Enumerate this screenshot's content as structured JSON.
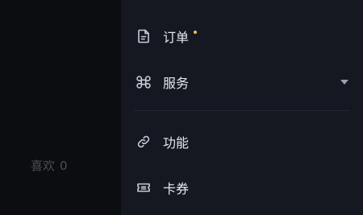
{
  "background": {
    "likes_label": "喜欢",
    "likes_count": "0"
  },
  "menu": {
    "items": [
      {
        "label": "订单",
        "icon": "document-icon",
        "badge_dot": true
      },
      {
        "label": "服务",
        "icon": "command-icon",
        "expandable": true
      },
      {
        "label": "功能",
        "icon": "link-icon"
      },
      {
        "label": "卡券",
        "icon": "ticket-icon"
      }
    ]
  },
  "colors": {
    "drawer_bg": "#161821",
    "text": "#e6e8ee",
    "icon": "#c9ccd6",
    "muted_text": "#4b4d55",
    "badge_dot": "#f2c14e"
  }
}
